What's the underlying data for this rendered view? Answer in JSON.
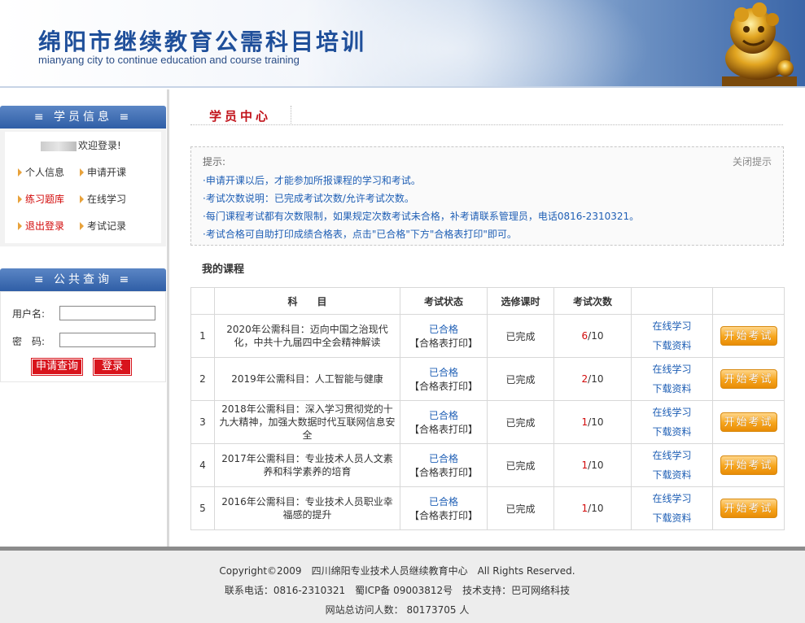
{
  "header": {
    "title": "绵阳市继续教育公需科目培训",
    "subtitle": "mianyang city to continue education and course training"
  },
  "sidebar": {
    "member_panel_title": "≡ 学员信息 ≡",
    "welcome_text": "欢迎登录!",
    "menu": [
      {
        "label": "个人信息",
        "color": "#333333"
      },
      {
        "label": "申请开课",
        "color": "#333333"
      },
      {
        "label": "练习题库",
        "color": "#d20a0a"
      },
      {
        "label": "在线学习",
        "color": "#333333"
      },
      {
        "label": "退出登录",
        "color": "#d20a0a"
      },
      {
        "label": "考试记录",
        "color": "#333333"
      }
    ],
    "query_panel_title": "≡ 公共查询 ≡",
    "username_label": "用户名:",
    "password_label": "密　码:",
    "apply_query_button": "申请查询",
    "login_button": "登录"
  },
  "main": {
    "section_title": "学员中心",
    "tips": {
      "label": "提示:",
      "close": "关闭提示",
      "lines": [
        "·申请开课以后，才能参加所报课程的学习和考试。",
        "·考试次数说明：已完成考试次数/允许考试次数。",
        "·每门课程考试都有次数限制，如果规定次数考试未合格，补考请联系管理员，电话0816-2310321。",
        "·考试合格可自助打印成绩合格表，点击\"已合格\"下方\"合格表打印\"即可。"
      ]
    },
    "my_courses_label": "我的课程",
    "table": {
      "headers": [
        "",
        "科　　目",
        "考试状态",
        "选修课时",
        "考试次数",
        "",
        ""
      ],
      "rows": [
        {
          "no": "1",
          "subject": "2020年公需科目：迈向中国之治现代化，中共十九届四中全会精神解读",
          "status": "已合格",
          "print": "【合格表打印】",
          "hours": "已完成",
          "count_done": "6",
          "count_total": "/10",
          "study": "在线学习",
          "download": "下载资料",
          "exam": "开始考试"
        },
        {
          "no": "2",
          "subject": "2019年公需科目：人工智能与健康",
          "status": "已合格",
          "print": "【合格表打印】",
          "hours": "已完成",
          "count_done": "2",
          "count_total": "/10",
          "study": "在线学习",
          "download": "下载资料",
          "exam": "开始考试"
        },
        {
          "no": "3",
          "subject": "2018年公需科目：深入学习贯彻党的十九大精神，加强大数据时代互联网信息安全",
          "status": "已合格",
          "print": "【合格表打印】",
          "hours": "已完成",
          "count_done": "1",
          "count_total": "/10",
          "study": "在线学习",
          "download": "下载资料",
          "exam": "开始考试"
        },
        {
          "no": "4",
          "subject": "2017年公需科目：专业技术人员人文素养和科学素养的培育",
          "status": "已合格",
          "print": "【合格表打印】",
          "hours": "已完成",
          "count_done": "1",
          "count_total": "/10",
          "study": "在线学习",
          "download": "下载资料",
          "exam": "开始考试"
        },
        {
          "no": "5",
          "subject": "2016年公需科目：专业技术人员职业幸福感的提升",
          "status": "已合格",
          "print": "【合格表打印】",
          "hours": "已完成",
          "count_done": "1",
          "count_total": "/10",
          "study": "在线学习",
          "download": "下载资料",
          "exam": "开始考试"
        }
      ]
    }
  },
  "footer": {
    "copyright": "Copyright©2009　四川绵阳专业技术人员继续教育中心　All Rights Reserved.",
    "contact": "联系电话：0816-2310321　蜀ICP备 09003812号　技术支持：巴可网络科技",
    "visitors": "网站总访问人数：  80173705 人"
  },
  "colors": {
    "brand_blue": "#1f4f9a",
    "accent_red": "#c1121a",
    "link_blue": "#1f5fb5",
    "button_orange": "#f7a51c"
  }
}
